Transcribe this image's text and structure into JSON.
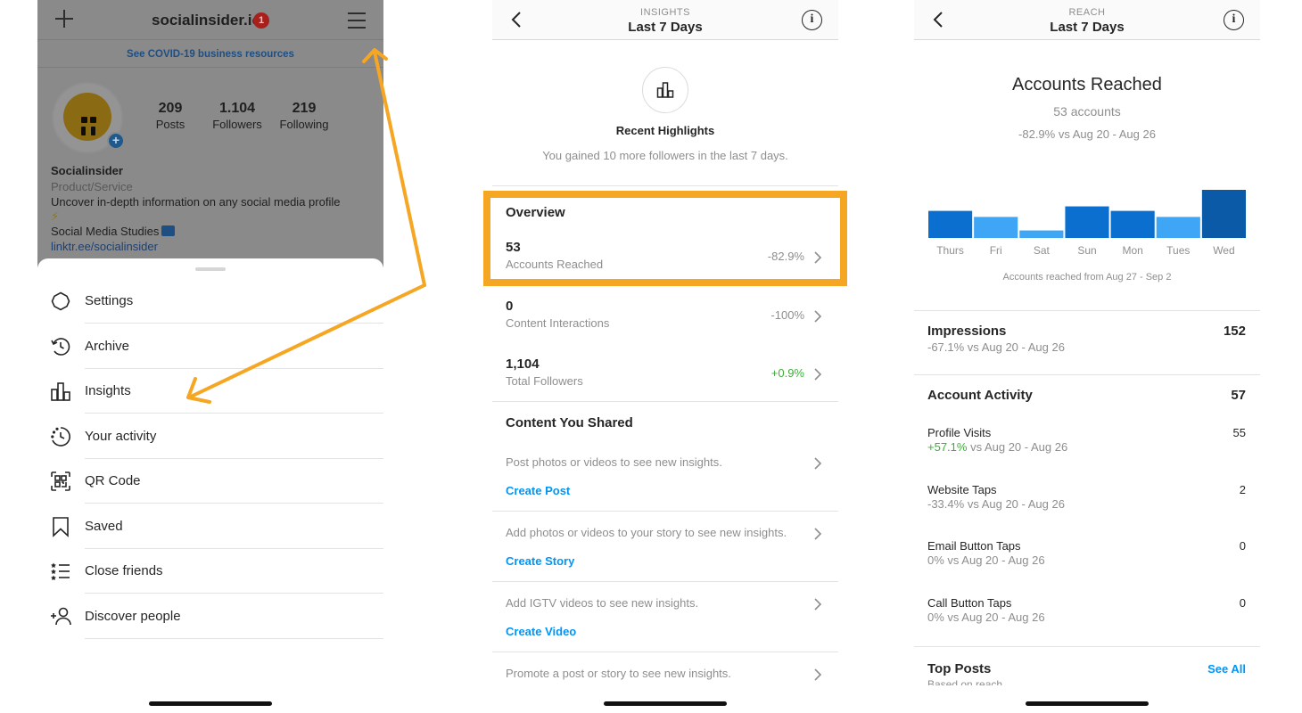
{
  "profile": {
    "username": "socialinsider.io",
    "notification_count": "1",
    "covid_banner": "See COVID-19 business resources",
    "stats": [
      {
        "value": "209",
        "label": "Posts"
      },
      {
        "value": "1.104",
        "label": "Followers"
      },
      {
        "value": "219",
        "label": "Following"
      }
    ],
    "name": "Socialinsider",
    "category": "Product/Service",
    "bio": "Uncover in-depth information on any social media profile",
    "bio_emoji": "⚡",
    "studies_label": "Social Media Studies",
    "link": "linktr.ee/socialinsider"
  },
  "menu": {
    "items": [
      {
        "label": "Settings",
        "icon": "settings-icon"
      },
      {
        "label": "Archive",
        "icon": "archive-icon"
      },
      {
        "label": "Insights",
        "icon": "insights-icon"
      },
      {
        "label": "Your activity",
        "icon": "activity-icon"
      },
      {
        "label": "QR Code",
        "icon": "qr-code-icon"
      },
      {
        "label": "Saved",
        "icon": "bookmark-icon"
      },
      {
        "label": "Close friends",
        "icon": "close-friends-icon"
      },
      {
        "label": "Discover people",
        "icon": "add-person-icon"
      }
    ]
  },
  "insights": {
    "overline": "INSIGHTS",
    "title": "Last 7 Days",
    "highlights_title": "Recent Highlights",
    "highlights_sub": "You gained 10 more followers in the last 7 days.",
    "overview_title": "Overview",
    "overview": [
      {
        "value": "53",
        "label": "Accounts Reached",
        "change": "-82.9%",
        "change_color": "#8e8e8e"
      },
      {
        "value": "0",
        "label": "Content Interactions",
        "change": "-100%",
        "change_color": "#8e8e8e"
      },
      {
        "value": "1,104",
        "label": "Total Followers",
        "change": "+0.9%",
        "change_color": "#3fae39"
      }
    ],
    "shared_title": "Content You Shared",
    "shared": [
      {
        "text": "Post photos or videos to see new insights.",
        "link": "Create Post"
      },
      {
        "text": "Add photos or videos to your story to see new insights.",
        "link": "Create Story"
      },
      {
        "text": "Add IGTV videos to see new insights.",
        "link": "Create Video"
      },
      {
        "text": "Promote a post or story to see new insights.",
        "link": ""
      }
    ]
  },
  "reach": {
    "overline": "REACH",
    "title": "Last 7 Days",
    "heading": "Accounts Reached",
    "count": "53 accounts",
    "comparison": "-82.9% vs Aug 20 - Aug 26",
    "chart_caption": "Accounts reached from Aug 27 - Sep 2",
    "impressions": {
      "label": "Impressions",
      "value": "152",
      "sub": "-67.1% vs Aug 20 - Aug 26"
    },
    "activity": {
      "label": "Account Activity",
      "value": "57"
    },
    "metrics": [
      {
        "label": "Profile Visits",
        "value": "55",
        "change": "+57.1%",
        "sub": " vs Aug 20 - Aug 26",
        "positive": true
      },
      {
        "label": "Website Taps",
        "value": "2",
        "change": "-33.4%",
        "sub": " vs Aug 20 - Aug 26",
        "positive": false
      },
      {
        "label": "Email Button Taps",
        "value": "0",
        "change": "0%",
        "sub": " vs Aug 20 - Aug 26",
        "positive": false
      },
      {
        "label": "Call Button Taps",
        "value": "0",
        "change": "0%",
        "sub": " vs Aug 20 - Aug 26",
        "positive": false
      }
    ],
    "top_posts": "Top Posts",
    "see_all": "See All",
    "top_posts_sub": "Based on reach"
  },
  "colors": {
    "accent": "#0095f6",
    "positive": "#3fae39",
    "annotation": "#f5a623",
    "bar_dark": "#0a5aa8",
    "bar_mid": "#0a6fcf",
    "bar_light": "#3ea6f5"
  },
  "chart_data": {
    "type": "bar",
    "categories": [
      "Thurs",
      "Fri",
      "Sat",
      "Sun",
      "Mon",
      "Tues",
      "Wed"
    ],
    "values": [
      9,
      7,
      2.5,
      10.5,
      9,
      7,
      16
    ]
  }
}
